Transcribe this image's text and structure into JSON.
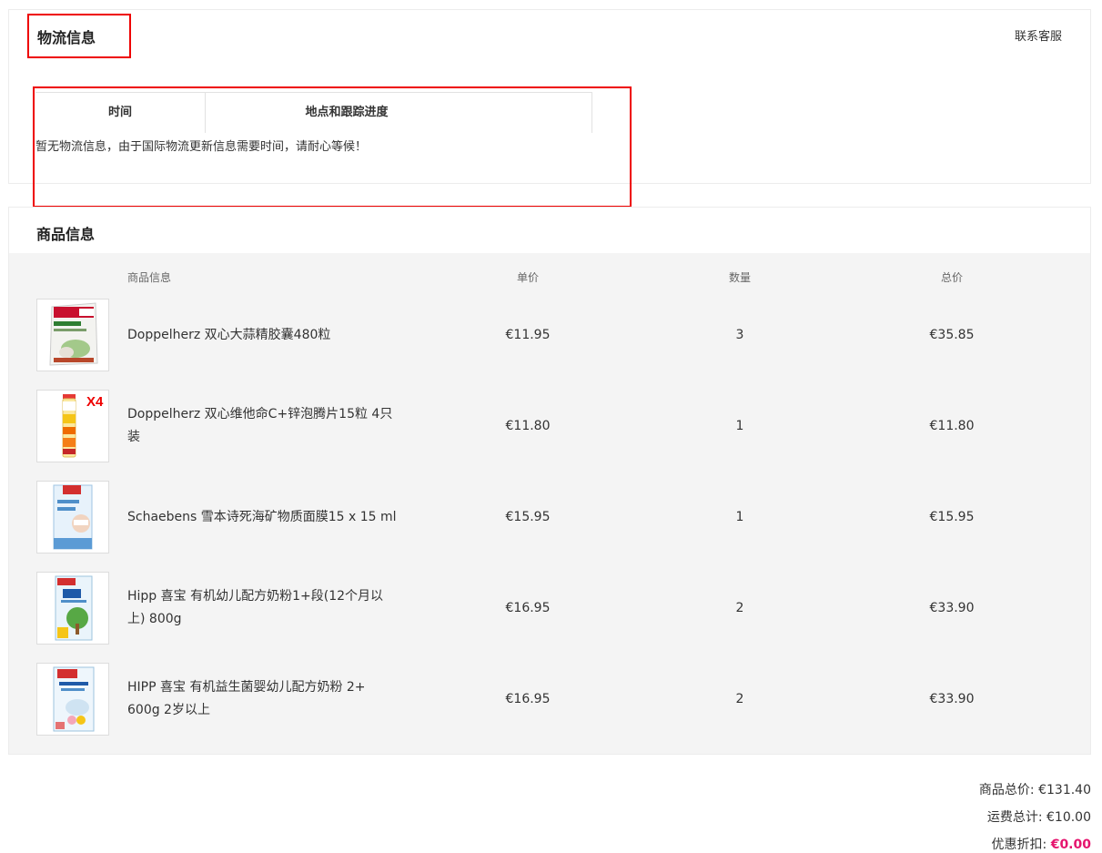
{
  "logistics": {
    "title": "物流信息",
    "contact_label": "联系客服",
    "table_headers": [
      "时间",
      "地点和跟踪进度"
    ],
    "empty_message": "暂无物流信息，由于国际物流更新信息需要时间，请耐心等候！"
  },
  "goods": {
    "title": "商品信息",
    "headers": {
      "info": "商品信息",
      "unit_price": "单价",
      "quantity": "数量",
      "total": "总价"
    },
    "items": [
      {
        "name": "Doppelherz 双心大蒜精胶囊480粒",
        "price": "€11.95",
        "qty": "3",
        "total": "€35.85",
        "image": "garlic-capsule-box"
      },
      {
        "name": "Doppelherz 双心维他命C+锌泡腾片15粒 4只装",
        "price": "€11.80",
        "qty": "1",
        "total": "€11.80",
        "image": "effervescent-tube",
        "image_badge": "X4"
      },
      {
        "name": "Schaebens 雪本诗死海矿物质面膜15 x 15 ml",
        "price": "€15.95",
        "qty": "1",
        "total": "€15.95",
        "image": "face-mask-sachet"
      },
      {
        "name": "Hipp 喜宝 有机幼儿配方奶粉1+段(12个月以上) 800g",
        "price": "€16.95",
        "qty": "2",
        "total": "€33.90",
        "image": "hipp-bio-box"
      },
      {
        "name": "HIPP 喜宝 有机益生菌婴幼儿配方奶粉 2+ 600g 2岁以上",
        "price": "€16.95",
        "qty": "2",
        "total": "€33.90",
        "image": "hipp-kindermilch-box"
      }
    ]
  },
  "summary": {
    "goods_total_label": "商品总价:",
    "goods_total_value": "€131.40",
    "shipping_label": "运费总计:",
    "shipping_value": "€10.00",
    "discount_label": "优惠折扣:",
    "discount_value": "€0.00"
  },
  "colors": {
    "highlight_box": "#e00000",
    "discount_accent": "#e5146e",
    "table_background": "#f4f4f4"
  }
}
